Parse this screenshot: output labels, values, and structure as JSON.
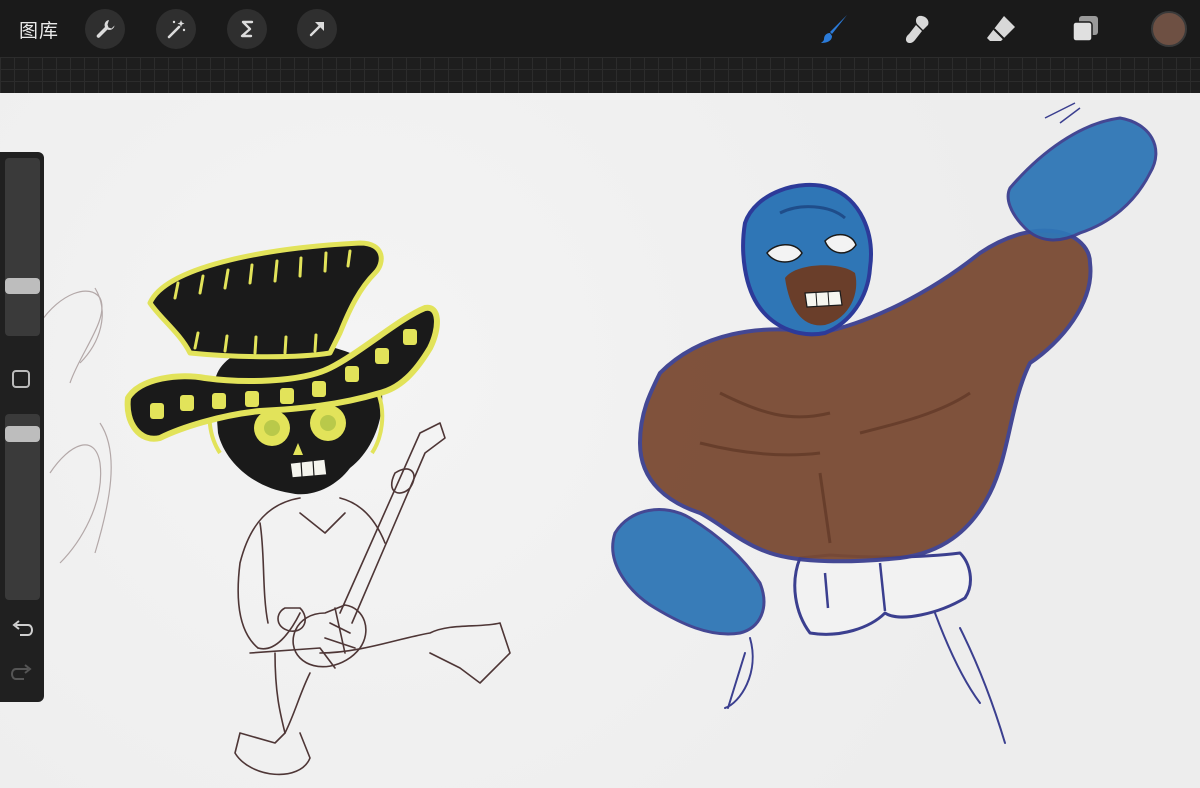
{
  "toolbar": {
    "gallery_label": "图库",
    "left_tools": [
      "wrench-icon",
      "magic-wand-icon",
      "selection-s-icon",
      "move-arrow-icon"
    ],
    "right_tools": [
      "brush-icon",
      "smudge-icon",
      "eraser-icon",
      "layers-icon"
    ],
    "active_tool": "brush-icon",
    "active_tool_color": "#2b7bd9",
    "current_color": "#6e5043"
  },
  "sidebar": {
    "brush_size_level": 0.26,
    "opacity_level": 0.93,
    "modify_button": "square-icon",
    "undo": "undo-icon",
    "redo": "redo-icon"
  },
  "canvas": {
    "background": "#efefef",
    "paint_colors": {
      "black": "#1a1a1a",
      "yellow": "#e2e35a",
      "blue": "#2f76b6",
      "brown": "#7a4a33",
      "pencil": "#5a4040"
    }
  }
}
